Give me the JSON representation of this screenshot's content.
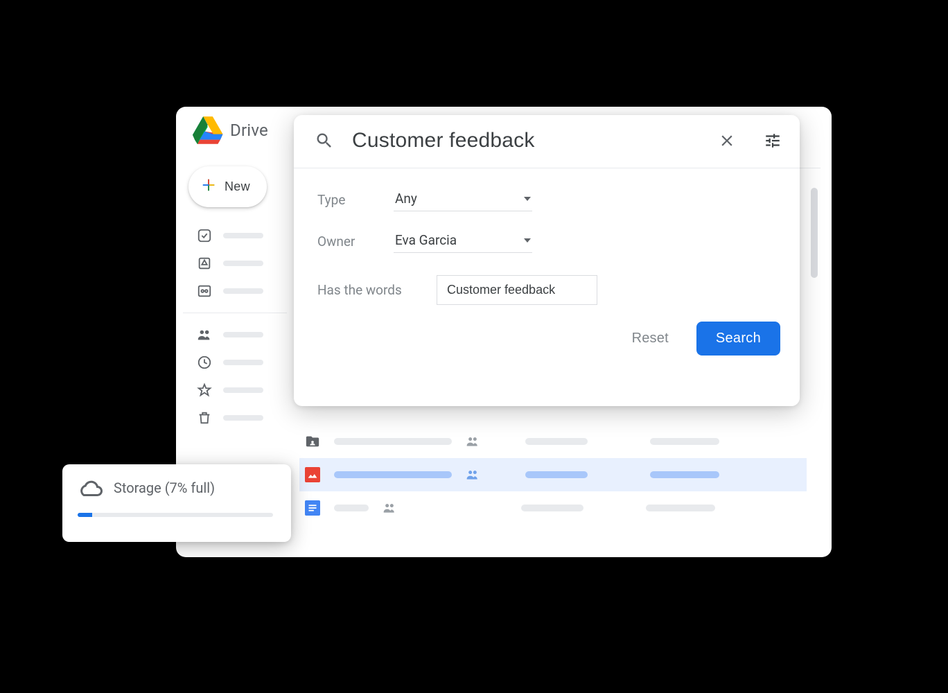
{
  "app": {
    "title": "Drive"
  },
  "new_button": {
    "label": "New"
  },
  "search": {
    "query": "Customer feedback",
    "filters": {
      "type_label": "Type",
      "type_value": "Any",
      "owner_label": "Owner",
      "owner_value": "Eva Garcia",
      "words_label": "Has the words",
      "words_value": "Customer feedback"
    },
    "reset_label": "Reset",
    "search_label": "Search"
  },
  "storage": {
    "label": "Storage (7% full)",
    "percent": 7
  },
  "colors": {
    "accent": "#1a73e8"
  }
}
